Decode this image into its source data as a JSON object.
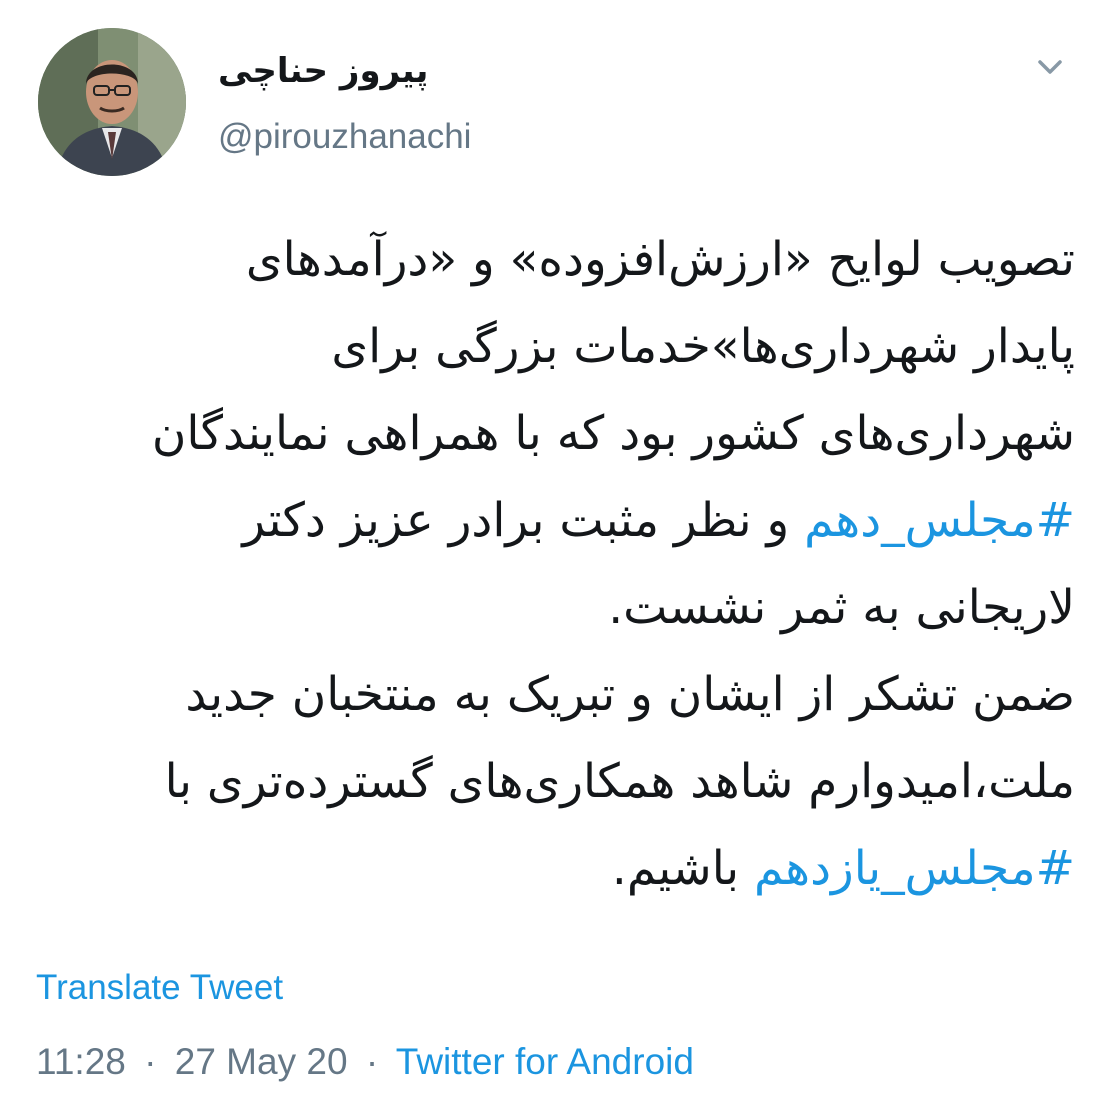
{
  "author": {
    "display_name": "پیروز حناچی",
    "handle": "@pirouzhanachi",
    "avatar_icon": "profile-photo"
  },
  "menu": {
    "icon": "chevron-down-icon"
  },
  "tweet": {
    "lines": [
      [
        {
          "text": "تصویب لوایح «ارزش‌افزوده» و «درآمدهای"
        }
      ],
      [
        {
          "text": "پایدار شهرداری‌ها»خدمات بزرگی برای"
        }
      ],
      [
        {
          "text": "شهرداری‌های کشور بود که با همراهی نمایندگان"
        }
      ],
      [
        {
          "text": "#مجلس_دهم",
          "hashtag": true
        },
        {
          "text": " و نظر مثبت برادر عزیز دکتر"
        }
      ],
      [
        {
          "text": "لاریجانی به ثمر نشست."
        }
      ],
      [
        {
          "text": "ضمن تشکر از ایشان و تبریک به منتخبان جدید"
        }
      ],
      [
        {
          "text": "ملت،امیدوارم شاهد همکاری‌های گسترده‌تری با"
        }
      ],
      [
        {
          "text": "#مجلس_یازدهم",
          "hashtag": true
        },
        {
          "text": " باشیم."
        }
      ]
    ]
  },
  "translate_label": "Translate Tweet",
  "meta": {
    "time": "11:28",
    "separator": "·",
    "date": "27 May 20",
    "source": "Twitter for Android"
  },
  "colors": {
    "link": "#1b95e0",
    "text": "#14171a",
    "secondary": "#657786"
  }
}
